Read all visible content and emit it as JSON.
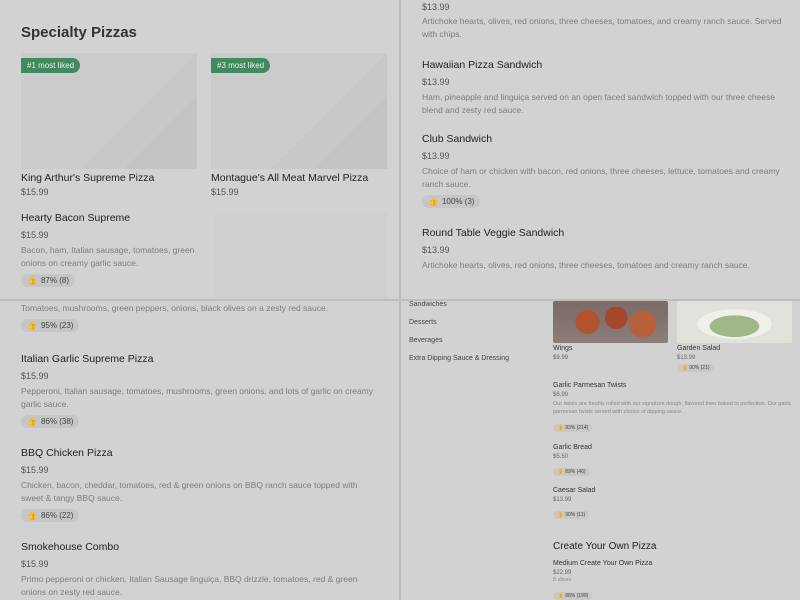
{
  "q1": {
    "section_title": "Specialty Pizzas",
    "cards": [
      {
        "badge": "#1 most liked",
        "name": "King Arthur's Supreme Pizza",
        "price": "$15.99"
      },
      {
        "badge": "#3 most liked",
        "name": "Montague's All Meat Marvel Pizza",
        "price": "$15.99"
      }
    ],
    "item": {
      "name": "Hearty Bacon Supreme",
      "price": "$15.99",
      "desc": "Bacon, ham, Italian sausage, tomatoes, green onions on creamy garlic sauce.",
      "rating": "87% (8)"
    }
  },
  "q2": {
    "top_price": "$13.99",
    "top_desc": "Artichoke hearts, olives, red onions, three cheeses, tomatoes, and creamy ranch sauce. Served with chips.",
    "items": [
      {
        "name": "Hawaiian Pizza Sandwich",
        "price": "$13.99",
        "desc": "Ham, pineapple and linguiça served on an open faced sandwich topped with our three cheese blend and zesty red sauce."
      },
      {
        "name": "Club Sandwich",
        "price": "$13.99",
        "desc": "Choice of ham or chicken with bacon, red onions, three cheeses, lettuce, tomatoes and creamy ranch sauce.",
        "rating": "100% (3)"
      },
      {
        "name": "Round Table Veggie Sandwich",
        "price": "$13.99",
        "desc": "Artichoke hearts, olives, red onions, three cheeses, tomatoes and creamy ranch sauce."
      }
    ]
  },
  "q3": {
    "top_desc": "Tomatoes, mushrooms, green peppers, onions, black olives on a zesty red sauce.",
    "top_rating": "95% (23)",
    "items": [
      {
        "name": "Italian Garlic Supreme Pizza",
        "price": "$15.99",
        "desc": "Pepperoni, Italian sausage, tomatoes, mushrooms, green onions, and lots of garlic on creamy garlic sauce.",
        "rating": "86% (38)"
      },
      {
        "name": "BBQ Chicken Pizza",
        "price": "$15.99",
        "desc": "Chicken, bacon, cheddar, tomatoes, red & green onions on BBQ ranch sauce topped with sweet & tangy BBQ sauce.",
        "rating": "86% (22)"
      },
      {
        "name": "Smokehouse Combo",
        "price": "$15.99",
        "desc": "Primo pepperoni or chicken, Italian Sausage linguiça, BBQ drizzle, tomatoes, red & green onions on zesty red sauce."
      }
    ]
  },
  "q4": {
    "sidebar": [
      "Sandwiches",
      "Desserts",
      "Beverages",
      "Extra Dipping Sauce & Dressing"
    ],
    "wings": {
      "name": "Wings",
      "price": "$9.99"
    },
    "salad": {
      "name": "Garden Salad",
      "price": "$13.99",
      "rating": "90% (21)"
    },
    "twists": {
      "name": "Garlic Parmesan Twists",
      "price": "$6.99",
      "desc": "Our twists are freshly rolled with our signature dough, flavored then baked to perfection. Our garlic parmesan twists served with choice of dipping sauce.",
      "rating": "93% (214)"
    },
    "bread": {
      "name": "Garlic Bread",
      "price": "$5.50",
      "rating": "89% (46)"
    },
    "caesar": {
      "name": "Caesar Salad",
      "price": "$13.99",
      "rating": "90% (11)"
    },
    "section_title": "Create Your Own Pizza",
    "cyo": {
      "name": "Medium Create Your Own Pizza",
      "price": "$22.99",
      "slices": "8 slices",
      "rating": "88% (189)"
    },
    "colors": {
      "wings": "#8a3b2a",
      "salad": "#e8e8e0"
    }
  }
}
